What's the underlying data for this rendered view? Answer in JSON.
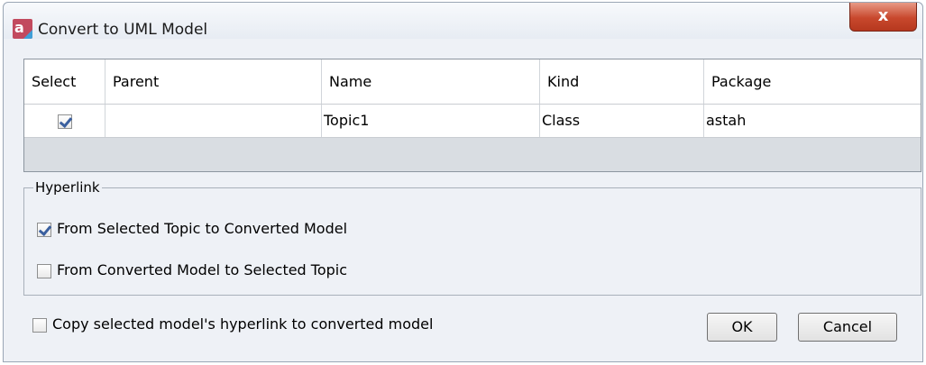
{
  "window": {
    "title": "Convert to UML Model",
    "close_label": "x"
  },
  "table": {
    "columns": [
      "Select",
      "Parent",
      "Name",
      "Kind",
      "Package"
    ],
    "rows": [
      {
        "selected": true,
        "parent": "",
        "name": "Topic1",
        "kind": "Class",
        "package": "astah"
      }
    ]
  },
  "hyperlink": {
    "legend": "Hyperlink",
    "options": [
      {
        "label": "From Selected Topic to Converted Model",
        "checked": true
      },
      {
        "label": "From Converted Model to Selected Topic",
        "checked": false
      }
    ]
  },
  "copy_option": {
    "label": "Copy selected model's hyperlink to converted model",
    "checked": false
  },
  "buttons": {
    "ok": "OK",
    "cancel": "Cancel"
  }
}
